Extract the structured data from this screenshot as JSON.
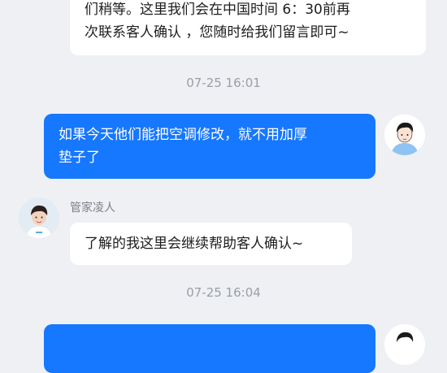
{
  "messages": [
    {
      "direction": "incoming",
      "lines": [
        "们稍等。这里我们会在中国时间 6：30前再",
        "次联系客人确认 ，您随时给我们留言即可~"
      ]
    },
    {
      "type": "timestamp",
      "text": "07-25 16:01"
    },
    {
      "direction": "outgoing",
      "lines": [
        "如果今天他们能把空调修改，就不用加厚",
        "垫子了"
      ],
      "avatar": "user-avatar-icon"
    },
    {
      "direction": "incoming",
      "sender": "管家凌人",
      "lines": [
        "了解的我这里会继续帮助客人确认~"
      ],
      "avatar": "agent-avatar-icon"
    },
    {
      "type": "timestamp",
      "text": "07-25 16:04"
    },
    {
      "direction": "outgoing",
      "lines": [
        ""
      ],
      "avatar": "user-avatar-icon"
    }
  ],
  "colors": {
    "background": "#eef0f4",
    "incoming_bubble": "#ffffff",
    "outgoing_bubble": "#1677ff",
    "timestamp_text": "#9a9ea6"
  }
}
